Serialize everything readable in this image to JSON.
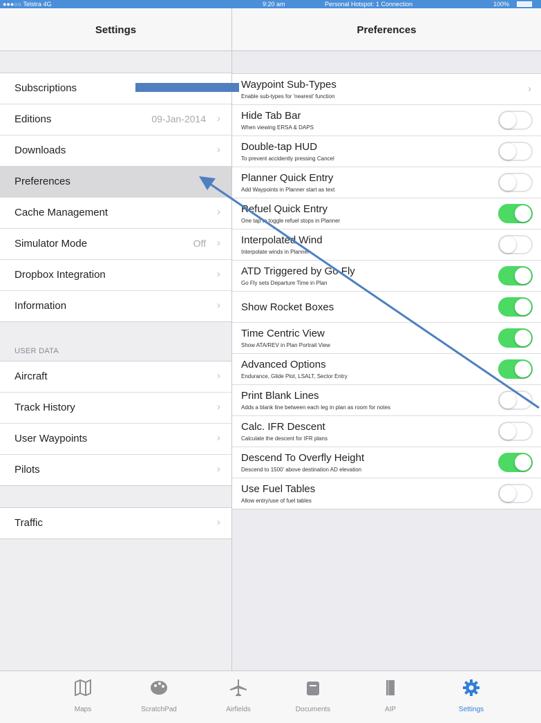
{
  "status": {
    "carrier": "●●●○○ Telstra  4G",
    "time": "9:20 am",
    "hotspot": "Personal Hotspot: 1 Connection",
    "battery": "100%"
  },
  "left": {
    "title": "Settings",
    "items": [
      {
        "label": "Subscriptions",
        "value": "",
        "chevron": ""
      },
      {
        "label": "Editions",
        "value": "09-Jan-2014",
        "chevron": "›"
      },
      {
        "label": "Downloads",
        "value": "",
        "chevron": "›"
      },
      {
        "label": "Preferences",
        "value": "",
        "chevron": ""
      },
      {
        "label": "Cache Management",
        "value": "",
        "chevron": "›"
      },
      {
        "label": "Simulator Mode",
        "value": "Off",
        "chevron": "›"
      },
      {
        "label": "Dropbox Integration",
        "value": "",
        "chevron": "›"
      },
      {
        "label": "Information",
        "value": "",
        "chevron": "›"
      }
    ],
    "user_data_header": "USER DATA",
    "user_items": [
      {
        "label": "Aircraft",
        "chevron": "›"
      },
      {
        "label": "Track History",
        "chevron": "›"
      },
      {
        "label": "User Waypoints",
        "chevron": "›"
      },
      {
        "label": "Pilots",
        "chevron": "›"
      }
    ],
    "traffic": {
      "label": "Traffic",
      "chevron": "›"
    }
  },
  "right": {
    "title": "Preferences",
    "items": [
      {
        "title": "Waypoint Sub-Types",
        "subtitle": "Enable sub-types for 'nearest' function",
        "control": "chevron",
        "chevron": "›"
      },
      {
        "title": "Hide Tab Bar",
        "subtitle": "When viewing ERSA & DAPS",
        "control": "toggle",
        "on": false
      },
      {
        "title": "Double-tap HUD",
        "subtitle": "To prevent accidently pressing Cancel",
        "control": "toggle",
        "on": false
      },
      {
        "title": "Planner Quick Entry",
        "subtitle": "Add Waypoints in Planner start as text",
        "control": "toggle",
        "on": false
      },
      {
        "title": "Refuel Quick Entry",
        "subtitle": "One tap to toggle refuel stops in Planner",
        "control": "toggle",
        "on": true
      },
      {
        "title": "Interpolated Wind",
        "subtitle": "Interpolate winds in Planner",
        "control": "toggle",
        "on": false
      },
      {
        "title": "ATD Triggered by Go Fly",
        "subtitle": "Go Fly sets Departure Time in Plan",
        "control": "toggle",
        "on": true
      },
      {
        "title": "Show Rocket Boxes",
        "subtitle": "",
        "control": "toggle",
        "on": true
      },
      {
        "title": "Time Centric View",
        "subtitle": "Show ATA/REV in Plan Portrait View",
        "control": "toggle",
        "on": true
      },
      {
        "title": "Advanced Options",
        "subtitle": "Endurance, Glide Plot, LSALT, Sector Entry",
        "control": "toggle",
        "on": true
      },
      {
        "title": "Print Blank Lines",
        "subtitle": "Adds a blank line between each leg in plan as room for notes",
        "control": "toggle",
        "on": false
      },
      {
        "title": "Calc. IFR Descent",
        "subtitle": "Calculate the descent for IFR plans",
        "control": "toggle",
        "on": false
      },
      {
        "title": "Descend To Overfly Height",
        "subtitle": "Descend to 1500' above destination AD elevation",
        "control": "toggle",
        "on": true
      },
      {
        "title": "Use Fuel Tables",
        "subtitle": "Allow entry/use of fuel tables",
        "control": "toggle",
        "on": false
      }
    ]
  },
  "tabbar": {
    "tabs": [
      {
        "label": "Maps",
        "icon": "map-icon",
        "active": false
      },
      {
        "label": "ScratchPad",
        "icon": "palette-icon",
        "active": false
      },
      {
        "label": "Airfields",
        "icon": "airplane-icon",
        "active": false
      },
      {
        "label": "Documents",
        "icon": "folder-icon",
        "active": false
      },
      {
        "label": "AIP",
        "icon": "book-icon",
        "active": false
      },
      {
        "label": "Settings",
        "icon": "gear-icon",
        "active": true
      }
    ]
  },
  "colors": {
    "status_bar": "#4a8fd8",
    "toggle_on": "#4cd964",
    "active_tab": "#2f7fd8",
    "annotation_arrow": "#4f7fbf"
  }
}
